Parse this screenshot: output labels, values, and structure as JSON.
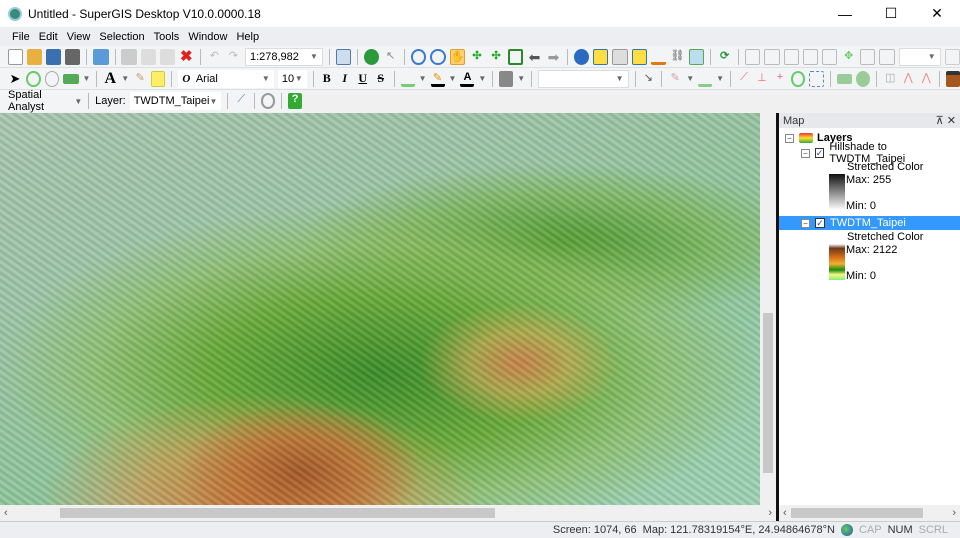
{
  "window": {
    "title": "Untitled - SuperGIS Desktop V10.0.0000.18",
    "minimize": "—",
    "maximize": "☐",
    "close": "✕"
  },
  "menu": [
    "File",
    "Edit",
    "View",
    "Selection",
    "Tools",
    "Window",
    "Help"
  ],
  "toolbar": {
    "scale": "1:278,982",
    "font": "Arial",
    "font_size": "10",
    "bold": "B",
    "italic": "I",
    "underline": "U",
    "strike": "S",
    "text_tool": "A"
  },
  "spatial": {
    "label": "Spatial Analyst",
    "layer_label": "Layer:",
    "layer_value": "TWDTM_Taipei"
  },
  "panel": {
    "title": "Map",
    "pin": "⊼",
    "close": "✕",
    "root": "Layers",
    "layers": [
      {
        "name": "Hillshade to TWDTM_Taipei",
        "renderer": "Stretched Color",
        "max": "Max: 255",
        "min": "Min: 0",
        "ramp": [
          "#111111",
          "#ffffff"
        ]
      },
      {
        "name": "TWDTM_Taipei",
        "renderer": "Stretched Color",
        "max": "Max: 2122",
        "min": "Min: 0",
        "ramp": [
          "#ffffff",
          "#6b3a1a",
          "#d06a18",
          "#f0b030",
          "#1a8a10",
          "#f8f880",
          "#80f080"
        ]
      }
    ]
  },
  "status": {
    "screen": "Screen: 1074, 66",
    "map": "Map: 121.78319154°E, 24.94864678°N",
    "cap": "CAP",
    "num": "NUM",
    "scrl": "SCRL"
  }
}
